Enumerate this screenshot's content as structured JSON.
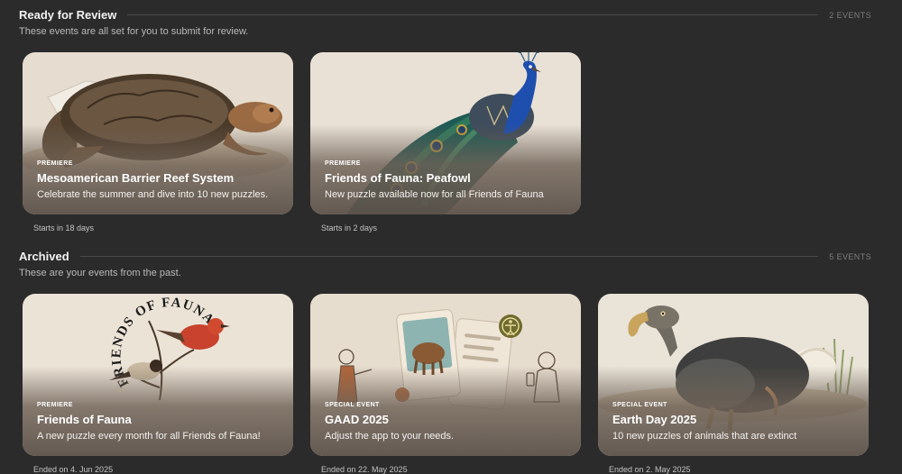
{
  "sections": [
    {
      "title": "Ready for Review",
      "count": "2 EVENTS",
      "subtitle": "These events are all set for you to submit for review.",
      "cards": [
        {
          "kind": "PREMIERE",
          "title": "Mesoamerican Barrier Reef System",
          "description": "Celebrate the summer and dive into 10 new puzzles.",
          "status": "Starts in 18 days",
          "art": "sea-turtle-illustration"
        },
        {
          "kind": "PREMIERE",
          "title": "Friends of Fauna: Peafowl",
          "description": "New puzzle available now for all Friends of Fauna",
          "status": "Starts in 2 days",
          "art": "peacock-illustration"
        }
      ]
    },
    {
      "title": "Archived",
      "count": "5 EVENTS",
      "subtitle": "These are your events from the past.",
      "cards": [
        {
          "kind": "PREMIERE",
          "title": "Friends of Fauna",
          "description": "A new puzzle every month for all Friends of Fauna!",
          "status": "Ended on 4. Jun 2025",
          "art": "birds-badge-illustration",
          "art_text": "FRIENDS OF FAUNA"
        },
        {
          "kind": "SPECIAL EVENT",
          "title": "GAAD 2025",
          "description": "Adjust the app to your needs.",
          "status": "Ended on 22. May 2025",
          "art": "accessibility-cards-illustration"
        },
        {
          "kind": "SPECIAL EVENT",
          "title": "Earth Day 2025",
          "description": "10 new puzzles of animals that are extinct",
          "status": "Ended on 2. May 2025",
          "art": "dodo-illustration"
        }
      ]
    }
  ]
}
